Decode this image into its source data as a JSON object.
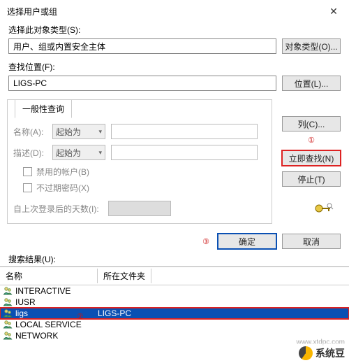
{
  "title": "选择用户或组",
  "object_type_section": {
    "label": "选择此对象类型(S):",
    "value": "用户、组或内置安全主体",
    "button": "对象类型(O)..."
  },
  "location_section": {
    "label": "查找位置(F):",
    "value": "LIGS-PC",
    "button": "位置(L)..."
  },
  "query_tab": "一般性查询",
  "name_label": "名称(A):",
  "name_combo": "起始为",
  "desc_label": "描述(D):",
  "desc_combo": "起始为",
  "chk_disabled": "禁用的帐户(B)",
  "chk_noexpire": "不过期密码(X)",
  "days_label": "自上次登录后的天数(I):",
  "side_buttons": {
    "columns": "列(C)...",
    "findnow": "立即查找(N)",
    "stop": "停止(T)"
  },
  "ok": "确定",
  "cancel": "取消",
  "results_label": "搜索结果(U):",
  "col_name": "名称",
  "col_folder": "所在文件夹",
  "rows": [
    {
      "name": "INTERACTIVE",
      "folder": ""
    },
    {
      "name": "IUSR",
      "folder": ""
    },
    {
      "name": "ligs",
      "folder": "LIGS-PC"
    },
    {
      "name": "LOCAL SERVICE",
      "folder": ""
    },
    {
      "name": "NETWORK",
      "folder": ""
    }
  ],
  "annotations": {
    "a1": "①",
    "a2": "②",
    "a3": "③"
  },
  "watermark": {
    "text": "系统豆",
    "url": "www.xtdpc.com"
  }
}
